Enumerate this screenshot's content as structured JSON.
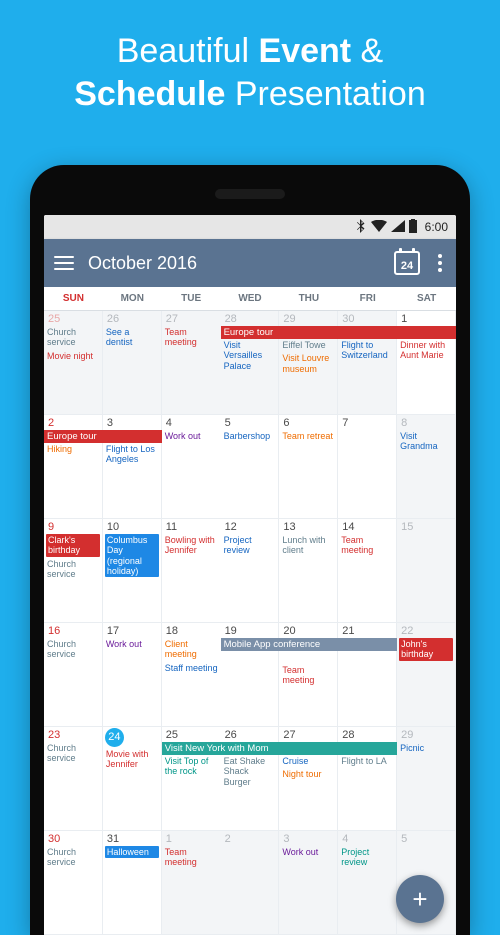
{
  "promo": {
    "line1a": "Beautiful ",
    "line1b": "Event",
    "line1c": " &",
    "line2a": "Schedule",
    "line2b": " Presentation"
  },
  "statusbar": {
    "time": "6:00"
  },
  "toolbar": {
    "title": "October 2016",
    "today": "24"
  },
  "weekdays": [
    "SUN",
    "MON",
    "TUE",
    "WED",
    "THU",
    "FRI",
    "SAT"
  ],
  "banners": {
    "europe1": "Europe tour",
    "europe2": "Europe tour",
    "mobileapp": "Mobile App conference",
    "nyc": "Visit New York with Mom"
  },
  "cells": {
    "d25p": {
      "num": "25",
      "ev": [
        {
          "t": "Church service",
          "c": "c-steel"
        },
        {
          "t": "Movie night",
          "c": "c-red"
        }
      ]
    },
    "d26p": {
      "num": "26",
      "ev": [
        {
          "t": "See a dentist",
          "c": "c-blue"
        }
      ]
    },
    "d27p": {
      "num": "27",
      "ev": [
        {
          "t": "Team meeting",
          "c": "c-red"
        }
      ]
    },
    "d28p": {
      "num": "28",
      "ev": [
        {
          "t": "Visit Versailles Palace",
          "c": "c-blue"
        }
      ]
    },
    "d29p": {
      "num": "29",
      "ev": [
        {
          "t": "Eiffel Towe",
          "c": "c-steel"
        },
        {
          "t": "Visit Louvre museum",
          "c": "c-orange"
        }
      ]
    },
    "d30p": {
      "num": "30",
      "ev": [
        {
          "t": "Flight to Switzerland",
          "c": "c-blue"
        }
      ]
    },
    "d1": {
      "num": "1",
      "ev": [
        {
          "t": "Dinner with Aunt Marie",
          "c": "c-red"
        }
      ]
    },
    "d2": {
      "num": "2",
      "ev": [
        {
          "t": "Hiking",
          "c": "c-orange"
        }
      ]
    },
    "d3": {
      "num": "3",
      "ev": [
        {
          "t": "Flight to Los Angeles",
          "c": "c-blue"
        }
      ]
    },
    "d4": {
      "num": "4",
      "ev": [
        {
          "t": "Work out",
          "c": "c-purple"
        }
      ]
    },
    "d5": {
      "num": "5",
      "ev": [
        {
          "t": "Barbershop",
          "c": "c-blue"
        }
      ]
    },
    "d6": {
      "num": "6",
      "ev": [
        {
          "t": "Team retreat",
          "c": "c-orange"
        }
      ]
    },
    "d7": {
      "num": "7",
      "ev": []
    },
    "d8": {
      "num": "8",
      "ev": [
        {
          "t": "Visit Grandma",
          "c": "c-blue"
        }
      ]
    },
    "d9": {
      "num": "9",
      "ev": [
        {
          "t": "Clark's birthday",
          "c": "fill f-red"
        },
        {
          "t": "Church service",
          "c": "c-steel"
        }
      ]
    },
    "d10": {
      "num": "10",
      "ev": [
        {
          "t": "Columbus Day (regional holiday)",
          "c": "fill f-blue"
        }
      ]
    },
    "d11": {
      "num": "11",
      "ev": [
        {
          "t": "Bowling with Jennifer",
          "c": "c-red"
        }
      ]
    },
    "d12": {
      "num": "12",
      "ev": [
        {
          "t": "Project review",
          "c": "c-blue"
        }
      ]
    },
    "d13": {
      "num": "13",
      "ev": [
        {
          "t": "Lunch with client",
          "c": "c-steel"
        }
      ]
    },
    "d14": {
      "num": "14",
      "ev": [
        {
          "t": "Team meeting",
          "c": "c-red"
        }
      ]
    },
    "d15": {
      "num": "15",
      "ev": []
    },
    "d16": {
      "num": "16",
      "ev": [
        {
          "t": "Church service",
          "c": "c-steel"
        }
      ]
    },
    "d17": {
      "num": "17",
      "ev": [
        {
          "t": "Work out",
          "c": "c-purple"
        }
      ]
    },
    "d18": {
      "num": "18",
      "ev": [
        {
          "t": "Client meeting",
          "c": "c-orange"
        },
        {
          "t": "Staff meeting",
          "c": "c-blue"
        }
      ]
    },
    "d19": {
      "num": "19",
      "ev": []
    },
    "d20": {
      "num": "20",
      "ev": [
        {
          "t": "Team meeting",
          "c": "c-red"
        }
      ]
    },
    "d21": {
      "num": "21",
      "ev": []
    },
    "d22": {
      "num": "22",
      "ev": [
        {
          "t": "John's birthday",
          "c": "fill f-red"
        }
      ]
    },
    "d23": {
      "num": "23",
      "ev": [
        {
          "t": "Church service",
          "c": "c-steel"
        }
      ]
    },
    "d24": {
      "num": "24",
      "ev": [
        {
          "t": "Movie with Jennifer",
          "c": "c-red"
        }
      ]
    },
    "d25": {
      "num": "25",
      "ev": [
        {
          "t": "Visit Top of the rock",
          "c": "c-teal"
        }
      ]
    },
    "d26": {
      "num": "26",
      "ev": [
        {
          "t": "Eat Shake Shack Burger",
          "c": "c-steel"
        }
      ]
    },
    "d27": {
      "num": "27",
      "ev": [
        {
          "t": "Cruise",
          "c": "c-blue"
        },
        {
          "t": "Night tour",
          "c": "c-orange"
        }
      ]
    },
    "d28": {
      "num": "28",
      "ev": [
        {
          "t": "Flight to LA",
          "c": "c-steel"
        }
      ]
    },
    "d29": {
      "num": "29",
      "ev": [
        {
          "t": "Picnic",
          "c": "c-blue"
        }
      ]
    },
    "d30": {
      "num": "30",
      "ev": [
        {
          "t": "Church service",
          "c": "c-steel"
        }
      ]
    },
    "d31": {
      "num": "31",
      "ev": [
        {
          "t": "Halloween",
          "c": "fill f-blue"
        }
      ]
    },
    "n1": {
      "num": "1",
      "ev": [
        {
          "t": "Team meeting",
          "c": "c-red"
        }
      ]
    },
    "n2": {
      "num": "2",
      "ev": []
    },
    "n3": {
      "num": "3",
      "ev": [
        {
          "t": "Work out",
          "c": "c-purple"
        }
      ]
    },
    "n4": {
      "num": "4",
      "ev": [
        {
          "t": "Project review",
          "c": "c-teal"
        }
      ]
    },
    "n5": {
      "num": "5",
      "ev": []
    }
  }
}
